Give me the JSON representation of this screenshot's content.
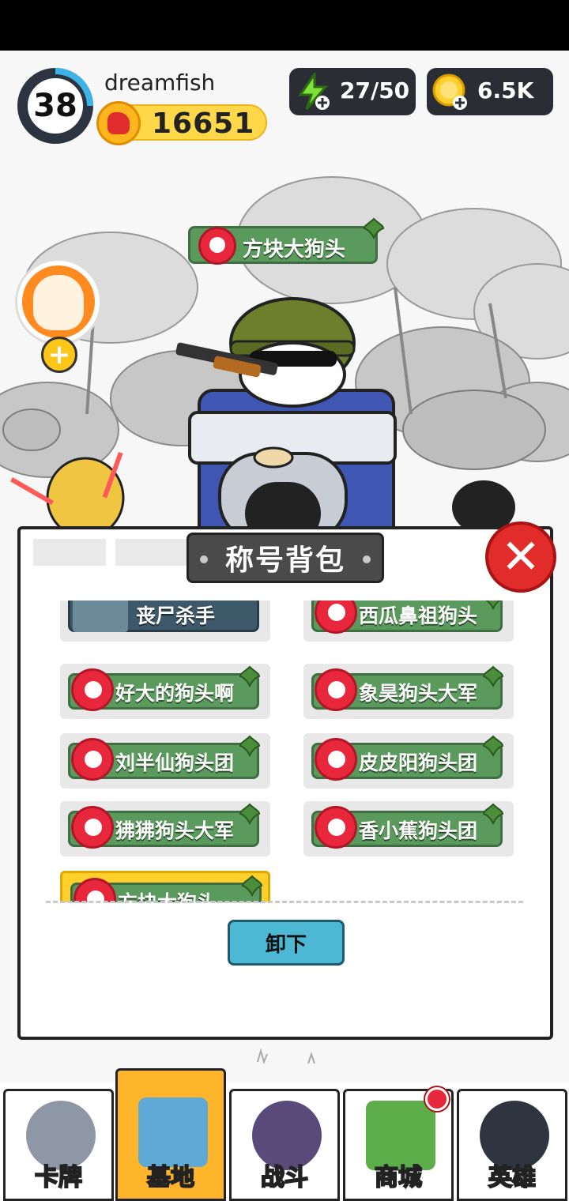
{
  "hud": {
    "level": "38",
    "username": "dreamfish",
    "score": "16651",
    "energy": "27/50",
    "coins": "6.5K"
  },
  "scene": {
    "current_title": "方块大狗头"
  },
  "modal": {
    "title": "称号背包",
    "close_label": "✕",
    "titles": [
      {
        "label": "丧尸杀手",
        "style": "zombie"
      },
      {
        "label": "西瓜鼻祖狗头",
        "style": "green"
      },
      {
        "label": "好大的狗头啊",
        "style": "green"
      },
      {
        "label": "象昊狗头大军",
        "style": "green"
      },
      {
        "label": "刘半仙狗头团",
        "style": "green"
      },
      {
        "label": "皮皮阳狗头团",
        "style": "green"
      },
      {
        "label": "狒狒狗头大军",
        "style": "green"
      },
      {
        "label": "香小蕉狗头团",
        "style": "green"
      },
      {
        "label": "方块大狗头",
        "style": "selected"
      }
    ],
    "unequip_label": "卸下"
  },
  "nav": {
    "items": [
      {
        "label": "卡牌",
        "icon": "husky-dog-icon"
      },
      {
        "label": "基地",
        "icon": "castle-icon"
      },
      {
        "label": "战斗",
        "icon": "paw-icon"
      },
      {
        "label": "商城",
        "icon": "money-icon"
      },
      {
        "label": "英雄",
        "icon": "hero-dog-icon"
      }
    ],
    "active": "基地"
  },
  "colors": {
    "title_green": "#5a9a5c",
    "play_red": "#e8273d",
    "nav_active": "#ffb52a",
    "unequip_blue": "#4cb8d4"
  }
}
